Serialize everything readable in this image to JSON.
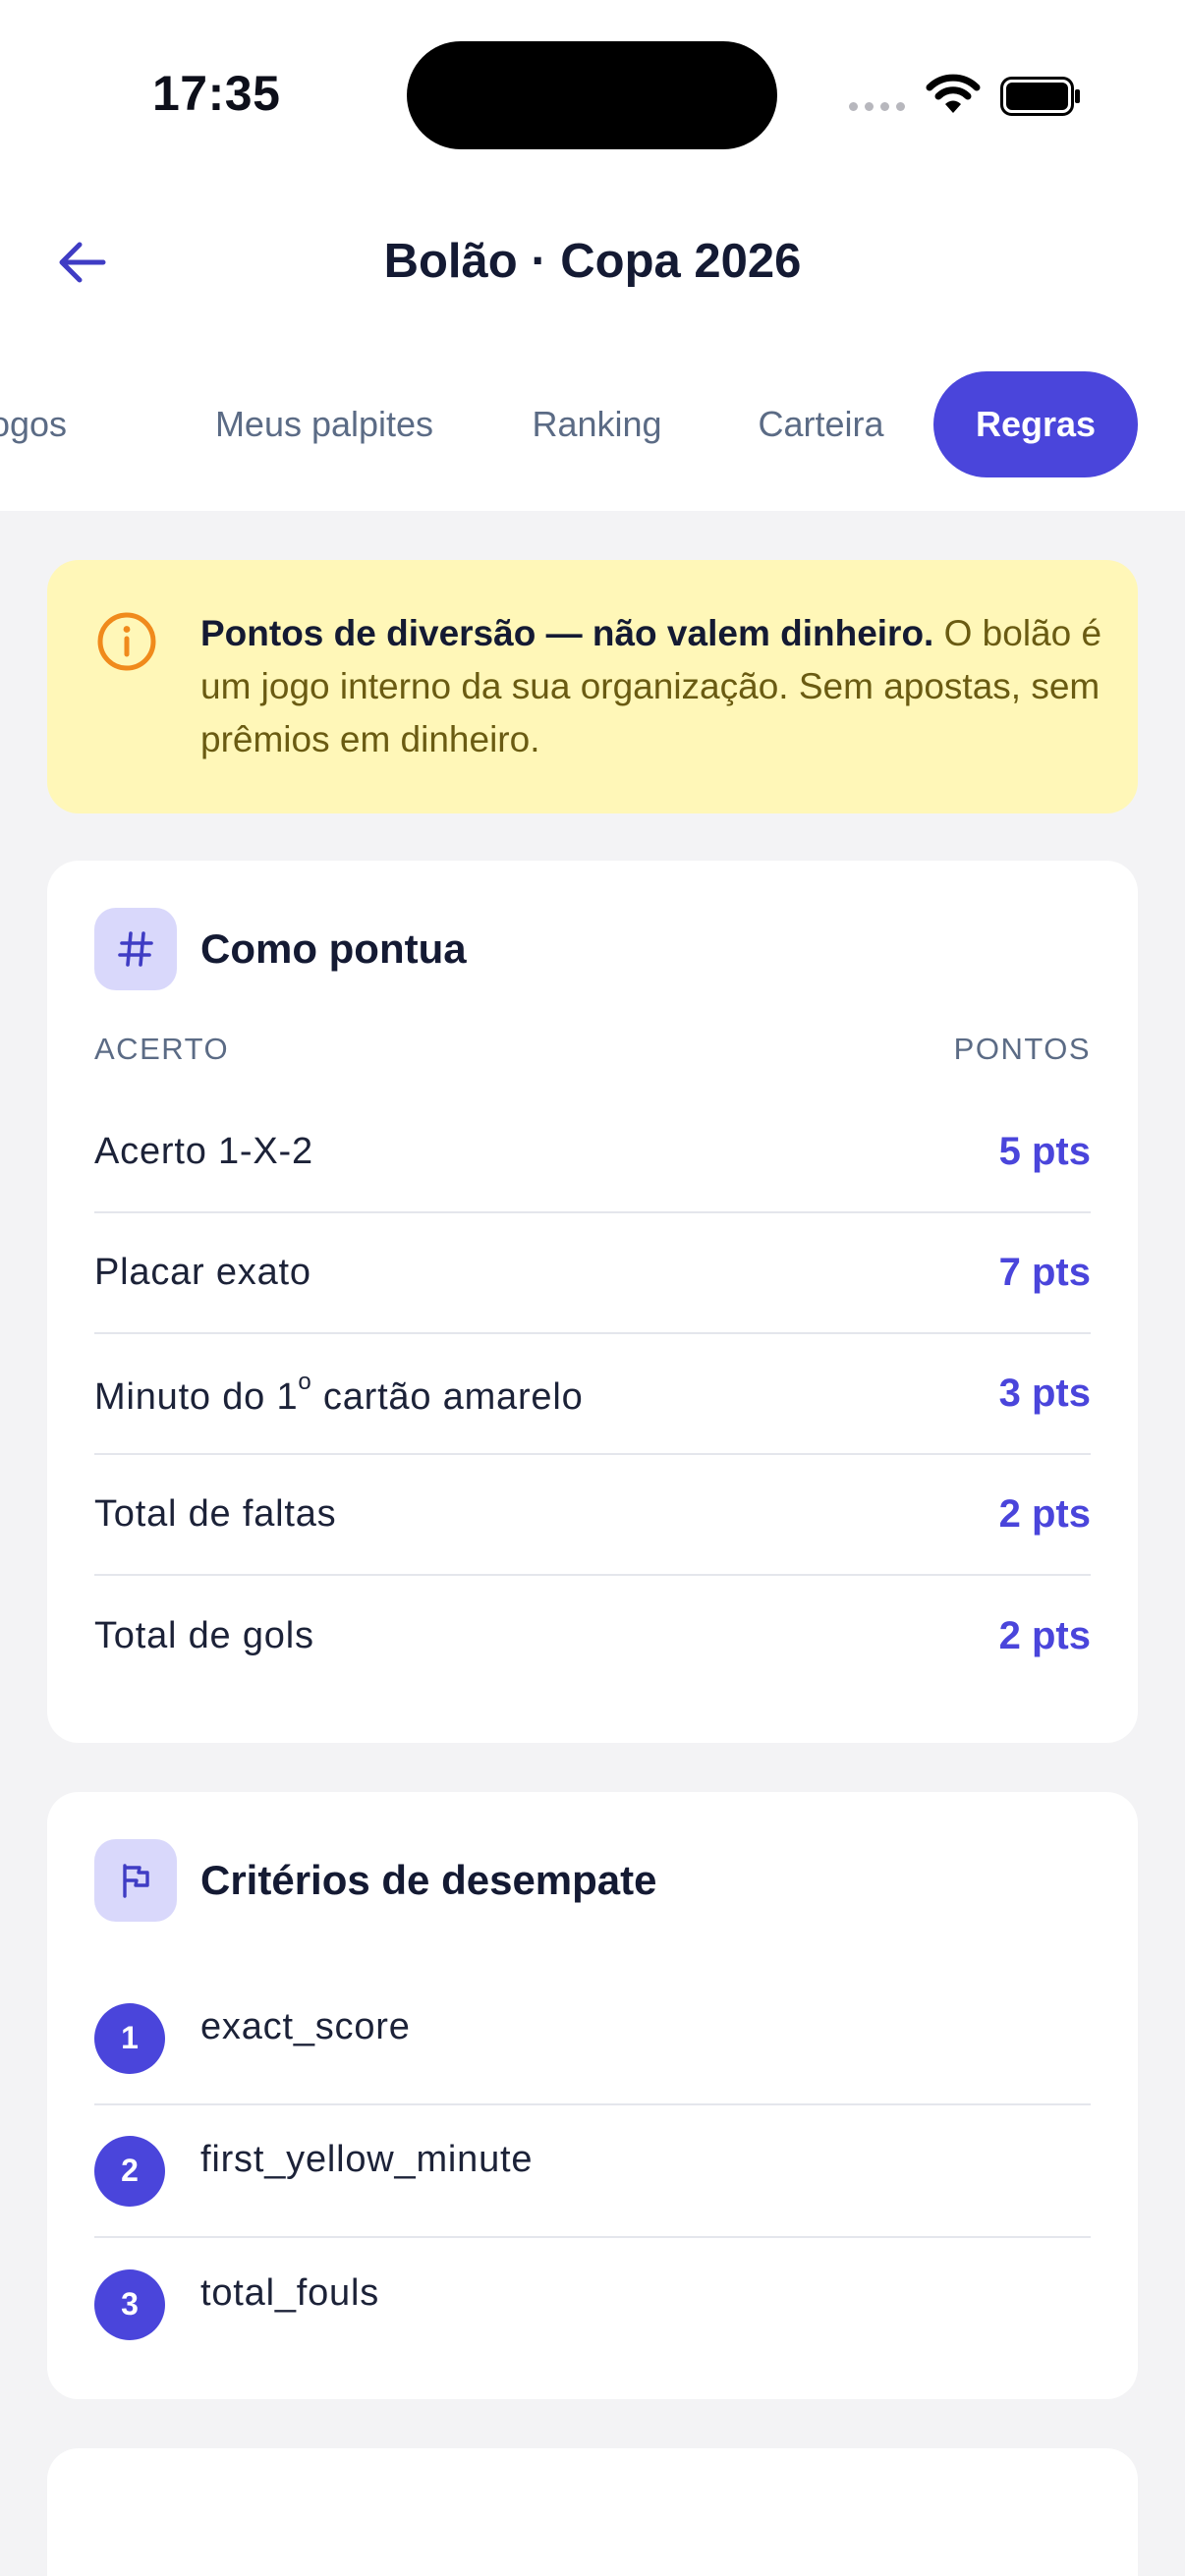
{
  "status_bar": {
    "time": "17:35"
  },
  "header": {
    "title": "Bolão · Copa 2026"
  },
  "tabs": [
    {
      "label": "Jogos"
    },
    {
      "label": "Meus palpites"
    },
    {
      "label": "Ranking"
    },
    {
      "label": "Carteira"
    },
    {
      "label": "Regras"
    }
  ],
  "active_tab": "Regras",
  "notice": {
    "bold": "Pontos de diversão — não valem dinheiro.",
    "text": " O bolão é um jogo interno da sua organização. Sem apostas, sem prêmios em dinheiro."
  },
  "scoring": {
    "title": "Como pontua",
    "col_left": "ACERTO",
    "col_right": "PONTOS",
    "rows": [
      {
        "label": "Acerto 1-X-2",
        "pts": "5 pts"
      },
      {
        "label": "Placar exato",
        "pts": "7 pts"
      },
      {
        "label_before": "Minuto do 1",
        "label_sup": "o",
        "label_after": " cartão amarelo",
        "pts": "3 pts"
      },
      {
        "label": "Total de faltas",
        "pts": "2 pts"
      },
      {
        "label": "Total de gols",
        "pts": "2 pts"
      }
    ]
  },
  "tiebreak": {
    "title": "Critérios de desempate",
    "items": [
      {
        "num": "1",
        "label": "exact_score"
      },
      {
        "num": "2",
        "label": "first_yellow_minute"
      },
      {
        "num": "3",
        "label": "total_fouls"
      }
    ]
  },
  "colors": {
    "accent": "#4a45db",
    "notice_bg": "#fff7b8",
    "notice_icon": "#f08a1c",
    "icon_badge_bg": "#d9d8fb",
    "page_bg": "#f3f3f5"
  },
  "icons": {
    "back": "arrow-left-icon",
    "notice": "info-circle-icon",
    "scoring": "hash-icon",
    "tiebreak": "flag-icon"
  }
}
